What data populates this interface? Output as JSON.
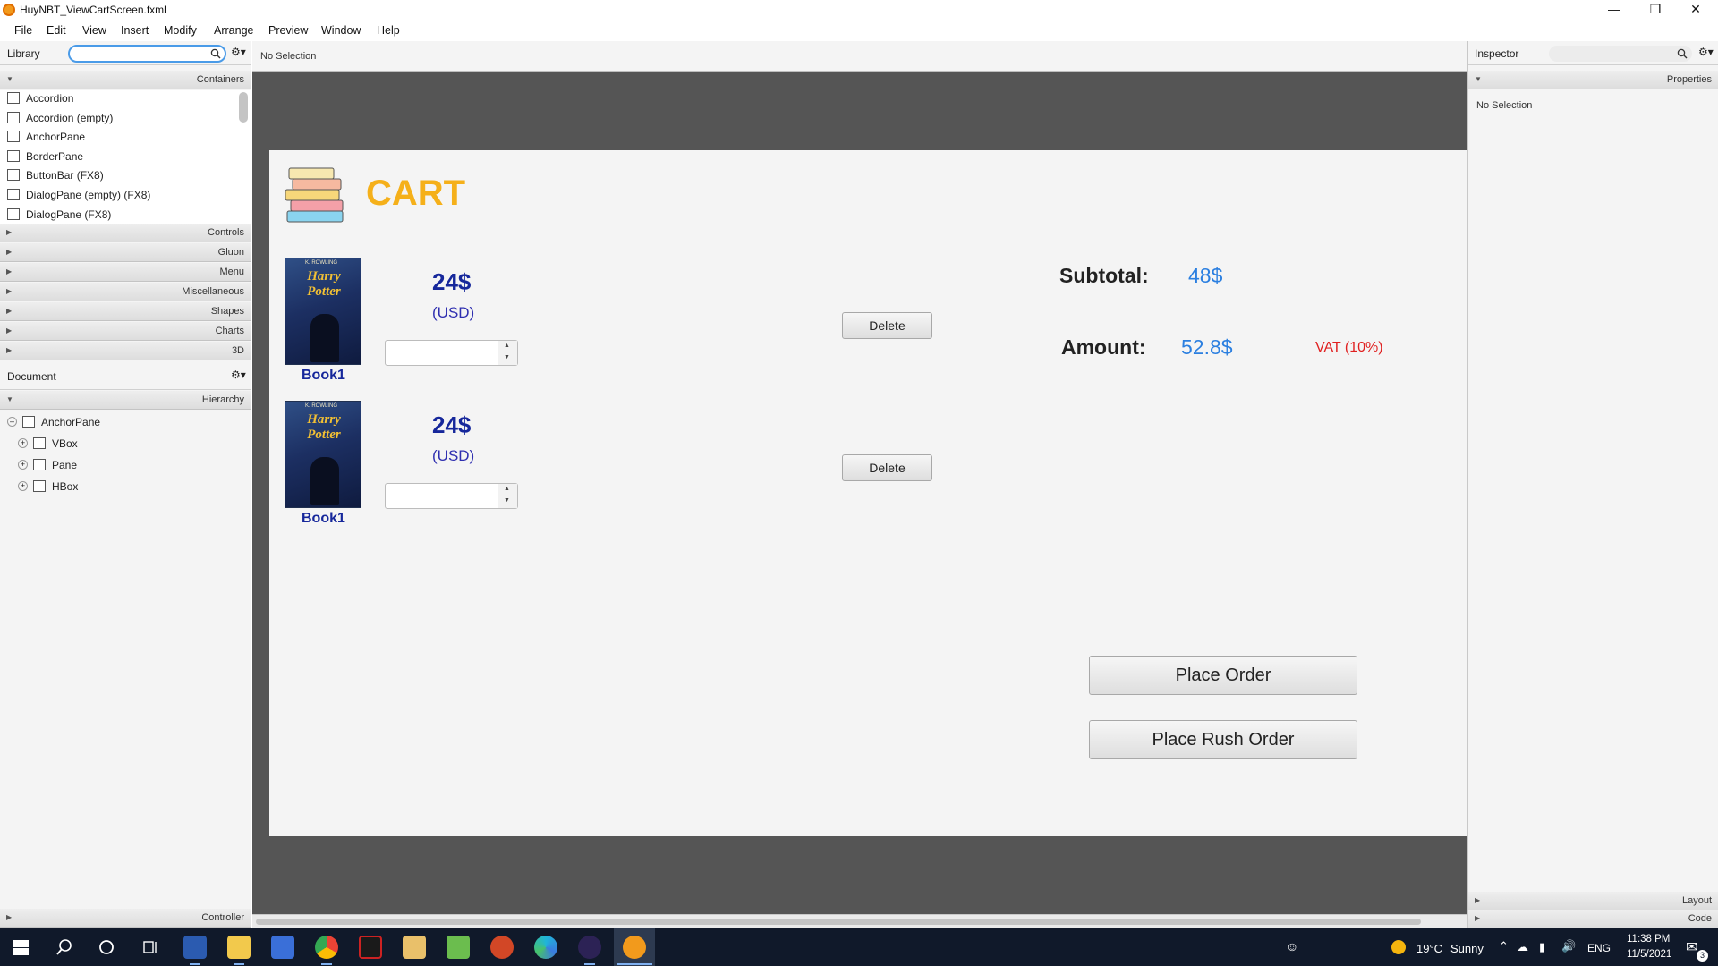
{
  "window": {
    "title": "HuyNBT_ViewCartScreen.fxml"
  },
  "menu": [
    "File",
    "Edit",
    "View",
    "Insert",
    "Modify",
    "Arrange",
    "Preview",
    "Window",
    "Help"
  ],
  "library": {
    "title": "Library",
    "containers_label": "Containers",
    "items": [
      "Accordion",
      "Accordion  (empty)",
      "AnchorPane",
      "BorderPane",
      "ButtonBar  (FX8)",
      "DialogPane (empty)  (FX8)",
      "DialogPane  (FX8)"
    ],
    "sections": [
      "Controls",
      "Gluon",
      "Menu",
      "Miscellaneous",
      "Shapes",
      "Charts",
      "3D"
    ]
  },
  "document": {
    "title": "Document",
    "hierarchy_label": "Hierarchy",
    "nodes": [
      "AnchorPane",
      "VBox",
      "Pane",
      "HBox"
    ],
    "controller_label": "Controller"
  },
  "center": {
    "selection_text": "No Selection"
  },
  "inspector": {
    "title": "Inspector",
    "properties_label": "Properties",
    "no_selection": "No Selection",
    "layout_label": "Layout",
    "code_label": "Code"
  },
  "cart": {
    "title": "CART",
    "items": [
      {
        "price": "24$",
        "currency": "(USD)",
        "name": "Book1",
        "cover_author": "K. ROWLING",
        "cover_title": "Harry Potter",
        "delete_label": "Delete"
      },
      {
        "price": "24$",
        "currency": "(USD)",
        "name": "Book1",
        "cover_author": "K. ROWLING",
        "cover_title": "Harry Potter",
        "delete_label": "Delete"
      }
    ],
    "subtotal_label": "Subtotal:",
    "subtotal_value": "48$",
    "amount_label": "Amount:",
    "amount_value": "52.8$",
    "vat_label": "VAT (10%)",
    "place_order_label": "Place Order",
    "place_rush_order_label": "Place Rush Order",
    "colors": {
      "title": "#f5b01a",
      "price": "#16279b",
      "value": "#2b7fe0",
      "vat": "#e02020"
    }
  },
  "taskbar": {
    "weather_temp": "19°C",
    "weather_desc": "Sunny",
    "language": "ENG",
    "time": "11:38 PM",
    "date": "11/5/2021",
    "notification_count": "3"
  }
}
